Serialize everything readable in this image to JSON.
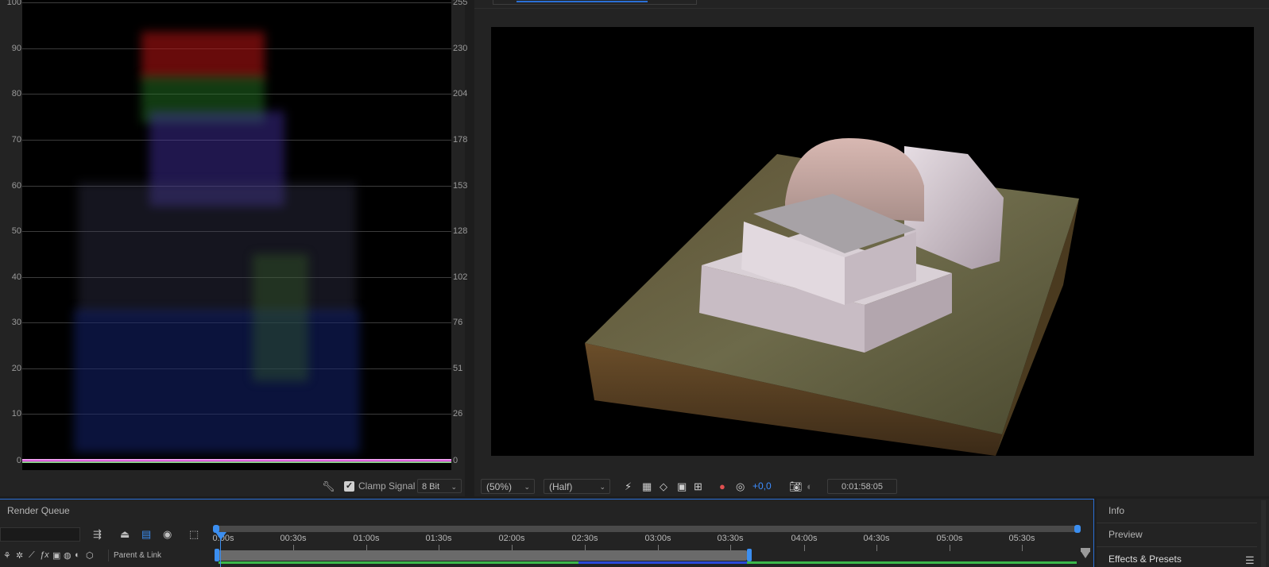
{
  "scope": {
    "left_ticks": [
      "100",
      "90",
      "80",
      "70",
      "60",
      "50",
      "40",
      "30",
      "20",
      "10",
      "0"
    ],
    "right_ticks": [
      "255",
      "230",
      "204",
      "178",
      "153",
      "128",
      "102",
      "76",
      "51",
      "26",
      "0"
    ],
    "clamp_signal_label": "Clamp Signal",
    "clamp_signal_checked": true,
    "bit_depth": "8 Bit",
    "icons": {
      "settings": "wrench-icon",
      "checkbox": "check-icon"
    }
  },
  "viewer": {
    "zoom": "(50%)",
    "resolution": "(Half)",
    "exposure": "+0,0",
    "timecode": "0:01:58:05",
    "icons": [
      "fast-previews-icon",
      "transparency-grid-icon",
      "mask-path-icon",
      "region-of-interest-icon",
      "guides-icon",
      "color-channels-icon",
      "reset-exposure-icon",
      "snapshot-icon",
      "show-snapshot-icon"
    ],
    "colors": {
      "accent": "#3c8dff",
      "background": "#000000"
    }
  },
  "timeline": {
    "panel_title": "Render Queue",
    "parent_link_label": "Parent & Link",
    "time_labels": [
      "0:00s",
      "00:30s",
      "01:00s",
      "01:30s",
      "02:00s",
      "02:30s",
      "03:00s",
      "03:30s",
      "04:00s",
      "04:30s",
      "05:00s",
      "05:30s"
    ],
    "playhead_time": "0:00s",
    "work_area_end": "03:35s",
    "accent": "#3b8ef0"
  },
  "right_panel": {
    "items": [
      "Info",
      "Preview",
      "Effects & Presets"
    ]
  }
}
